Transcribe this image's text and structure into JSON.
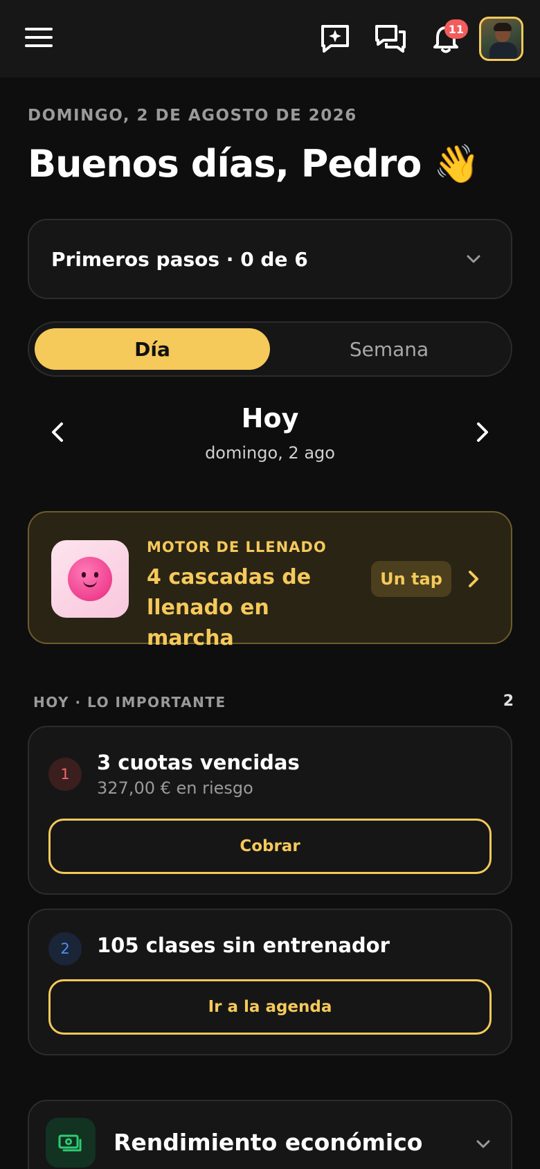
{
  "header": {
    "menu_icon": "hamburger-menu-icon",
    "ai_icon": "ai-sparkle-chat-icon",
    "messages_icon": "chat-bubbles-icon",
    "notifications_icon": "bell-icon",
    "notifications_count": "11",
    "avatar_icon": "user-avatar"
  },
  "date_line": "DOMINGO, 2 DE AGOSTO DE 2026",
  "greeting": "Buenos días, Pedro 👋",
  "steps": {
    "label": "Primeros pasos · 0 de 6"
  },
  "segment": {
    "day": "Día",
    "week": "Semana",
    "selected": "Día"
  },
  "day_nav": {
    "title": "Hoy",
    "subtitle": "domingo, 2 ago"
  },
  "motor": {
    "kicker": "MOTOR DE LLENADO",
    "title": "4 cascadas de llenado en marcha",
    "action": "Un tap"
  },
  "important": {
    "heading": "HOY · LO IMPORTANTE",
    "count": "2",
    "tasks": [
      {
        "number": "1",
        "title": "3 cuotas vencidas",
        "subtitle": "327,00 € en riesgo",
        "button": "Cobrar"
      },
      {
        "number": "2",
        "title": "105 clases sin entrenador",
        "button": "Ir a la agenda"
      }
    ]
  },
  "rendimiento": {
    "title": "Rendimiento económico"
  },
  "colors": {
    "accent": "#f5c95a",
    "background": "#0e0e0e",
    "card": "#161616",
    "badge": "#f25c5c",
    "danger": "#ef6a6a",
    "info": "#4d8ff5",
    "money": "#2ecc71"
  }
}
